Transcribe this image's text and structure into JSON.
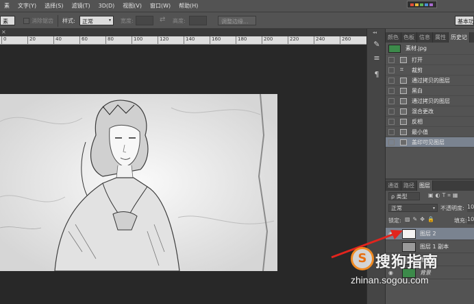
{
  "menu": {
    "items": [
      "素",
      "文字(Y)",
      "选择(S)",
      "滤镜(T)",
      "3D(D)",
      "视图(V)",
      "窗口(W)",
      "帮助(H)"
    ],
    "workspace_label": "基本功"
  },
  "options_bar": {
    "tool_label": "素",
    "antialias_label": "消除锯齿",
    "style_label": "样式:",
    "style_value": "正常",
    "width_label": "宽度:",
    "height_label": "高度:",
    "refine_edge_label": "调整边缘..."
  },
  "ruler": {
    "ticks": [
      "0",
      "20",
      "40",
      "60",
      "80",
      "100",
      "120",
      "140",
      "160",
      "180",
      "200",
      "220",
      "240",
      "260"
    ]
  },
  "history_panel": {
    "tabs": [
      "颜色",
      "色板",
      "信息",
      "属性",
      "历史记"
    ],
    "snapshot_label": "素材.jpg",
    "steps": [
      "打开",
      "裁剪",
      "通过拷贝的图层",
      "黑白",
      "通过拷贝的图层",
      "混合更改",
      "反相",
      "最小值",
      "盖印可见图层"
    ]
  },
  "layers_panel": {
    "tabs": [
      "通道",
      "路径",
      "图层"
    ],
    "filter_label": "ρ 类型",
    "blend_mode": "正常",
    "opacity_label": "不透明度:",
    "opacity_value": "10",
    "lock_label": "锁定:",
    "fill_label": "填充:",
    "fill_value": "10",
    "layers": [
      "图层 2",
      "图层 1 副本",
      "图层 1",
      "背景"
    ]
  },
  "watermark": {
    "text": "搜狗指南",
    "url": "zhinan.sogou.com",
    "logo_glyph": "S"
  },
  "colors": {
    "accent": "#f08a22",
    "selected_row": "#7a8390",
    "arrow": "#e2241d"
  }
}
